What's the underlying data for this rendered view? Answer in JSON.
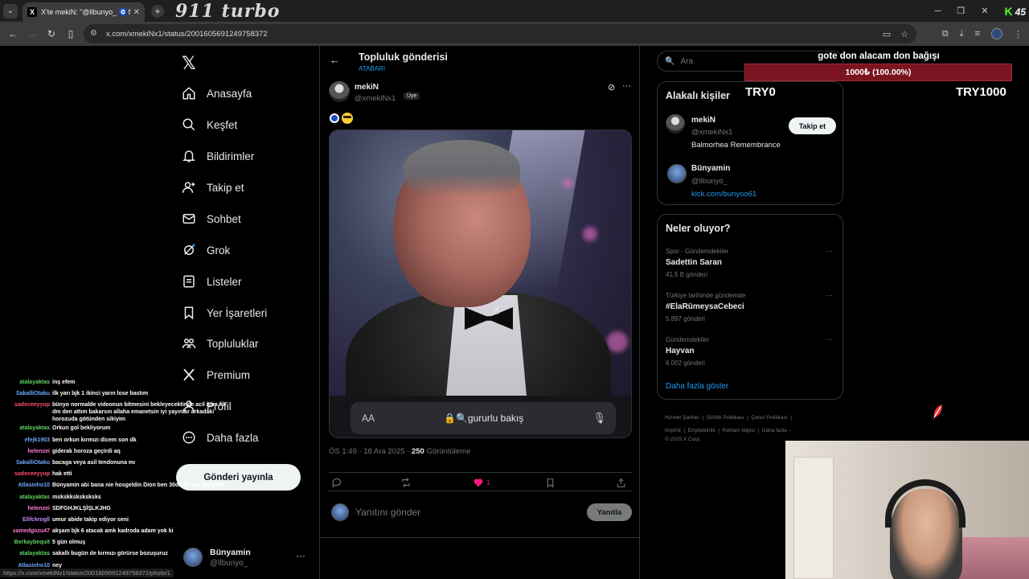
{
  "browser": {
    "tab_title": "X'te mekiN: \"@llbunyo_ 🧿😎",
    "url": "x.com/xmekiNx1/status/2001605691249758372",
    "status_url": "https://x.com/xmekiNx1/status/2001605691249758372/photo/1"
  },
  "overlay": {
    "brand_text": "911 turbo",
    "kick_count": "45",
    "donation_title": "gote don alacam don bağışı",
    "donation_progress": "1000₺ (100.00%)",
    "donation_percent": 100,
    "donation_min": "TRY0",
    "donation_max": "TRY1000",
    "chat": [
      {
        "user": "atalayaktas",
        "color": "#5fd35f",
        "msg": "inş efem"
      },
      {
        "user": "SakalliOtaku",
        "color": "#6fa8ff",
        "msg": "ilk yarı bjk 1 ikinci yarın lose bastım"
      },
      {
        "user": "sadeceeyyup",
        "color": "#ff4d6d",
        "msg": "bünyo normalde videonun bitmesini bekleyecektinde acil işim fik dm den attım bakarsın allaha emanetsin iyi yayınlar arkadaki horozuda götünden sikiyim"
      },
      {
        "user": "atalayaktas",
        "color": "#5fd35f",
        "msg": "Orkun gol bekliyorum"
      },
      {
        "user": "efejk1903",
        "color": "#6fa8ff",
        "msg": "ben orkun kırmızı dicem son dk"
      },
      {
        "user": "helenzei",
        "color": "#ff7ad9",
        "msg": "giderak horoza geçirdi aq"
      },
      {
        "user": "SakalliOtaku",
        "color": "#6fa8ff",
        "msg": "bacaga veya asil tendonuna mı"
      },
      {
        "user": "sadeceeyyup",
        "color": "#ff4d6d",
        "msg": "hak etti"
      },
      {
        "user": "Atlasinho10",
        "color": "#6fa8ff",
        "msg": "Bünyamin abi bana nie hosgeldin Dion ben 30dk dır burdayimaw"
      },
      {
        "user": "atalayaktas",
        "color": "#5fd35f",
        "msg": "mskskksksksksks"
      },
      {
        "user": "helenzei",
        "color": "#ff7ad9",
        "msg": "SDFGHJKLŞİŞLKJHG"
      },
      {
        "user": "Elifckrogll",
        "color": "#c48bff",
        "msg": "umur abide takip ediyor seni"
      },
      {
        "user": "samedgozu47",
        "color": "#ff7ad9",
        "msg": "akşam bjk 6 atacak amk kadroda adam yok ki"
      },
      {
        "user": "Berkaybequit",
        "color": "#5fd35f",
        "msg": "5 gün olmuş"
      },
      {
        "user": "atalayaktas",
        "color": "#5fd35f",
        "msg": "sakallı bugün de kırmızı görürse bozuşuruz"
      },
      {
        "user": "Atlasinho10",
        "color": "#6fa8ff",
        "msg": "ney"
      }
    ]
  },
  "nav": {
    "items": [
      {
        "label": "Anasayfa",
        "icon": "home-icon"
      },
      {
        "label": "Keşfet",
        "icon": "search-icon"
      },
      {
        "label": "Bildirimler",
        "icon": "bell-icon"
      },
      {
        "label": "Takip et",
        "icon": "add-user-icon"
      },
      {
        "label": "Sohbet",
        "icon": "mail-icon"
      },
      {
        "label": "Grok",
        "icon": "grok-icon"
      },
      {
        "label": "Listeler",
        "icon": "list-icon"
      },
      {
        "label": "Yer İşaretleri",
        "icon": "bookmark-icon"
      },
      {
        "label": "Topluluklar",
        "icon": "communities-icon"
      },
      {
        "label": "Premium",
        "icon": "x-icon"
      },
      {
        "label": "Profil",
        "icon": "profile-icon"
      },
      {
        "label": "Daha fazla",
        "icon": "more-circle-icon"
      }
    ],
    "post_button": "Gönderi yayınla",
    "account": {
      "name": "Bünyamin",
      "handle": "@llbunyo_"
    }
  },
  "post": {
    "header_title": "Topluluk gönderisi",
    "header_sub": "ATABARI",
    "author_name": "mekiN",
    "author_handle": "@xmekiNx1",
    "badge": "Üye",
    "media_search_text": "gururlu bakış",
    "media_aa": "AA",
    "time": "ÖS 1:49 · 18 Ara 2025 ·",
    "views": "250",
    "views_label": "Görüntüleme",
    "like_count": "1",
    "reply_placeholder": "Yanıtını gönder",
    "reply_button": "Yanıtla"
  },
  "sidebar": {
    "search_placeholder": "Ara",
    "relevant_title": "Alakalı kişiler",
    "people": [
      {
        "name": "mekiN",
        "handle": "@xmekiNx1",
        "bio": "Balmorhea Remembrance",
        "follow": "Takip et"
      },
      {
        "name": "Bünyamin",
        "handle": "@llbunyo_",
        "link": "kick.com/bunyoo61"
      }
    ],
    "trends_title": "Neler oluyor?",
    "trends": [
      {
        "meta": "Spor · Gündemdekiler",
        "name": "Sadettin Saran",
        "count": "41,5 B gönderi"
      },
      {
        "meta": "Türkiye tarihinde gündemde",
        "name": "#ElaRümeysaCebeci",
        "count": "5.897 gönderi"
      },
      {
        "meta": "Gündemdekiler",
        "name": "Hayvan",
        "count": "6.002 gönderi"
      }
    ],
    "show_more": "Daha fazla göster",
    "footer": [
      "Hizmet Şartları",
      "Gizlilik Politikası",
      "Çerez Politikası",
      "Imprint",
      "Erişilebilirlik",
      "Reklam bilgisi",
      "Daha fazla ···",
      "© 2025 X Corp."
    ]
  }
}
